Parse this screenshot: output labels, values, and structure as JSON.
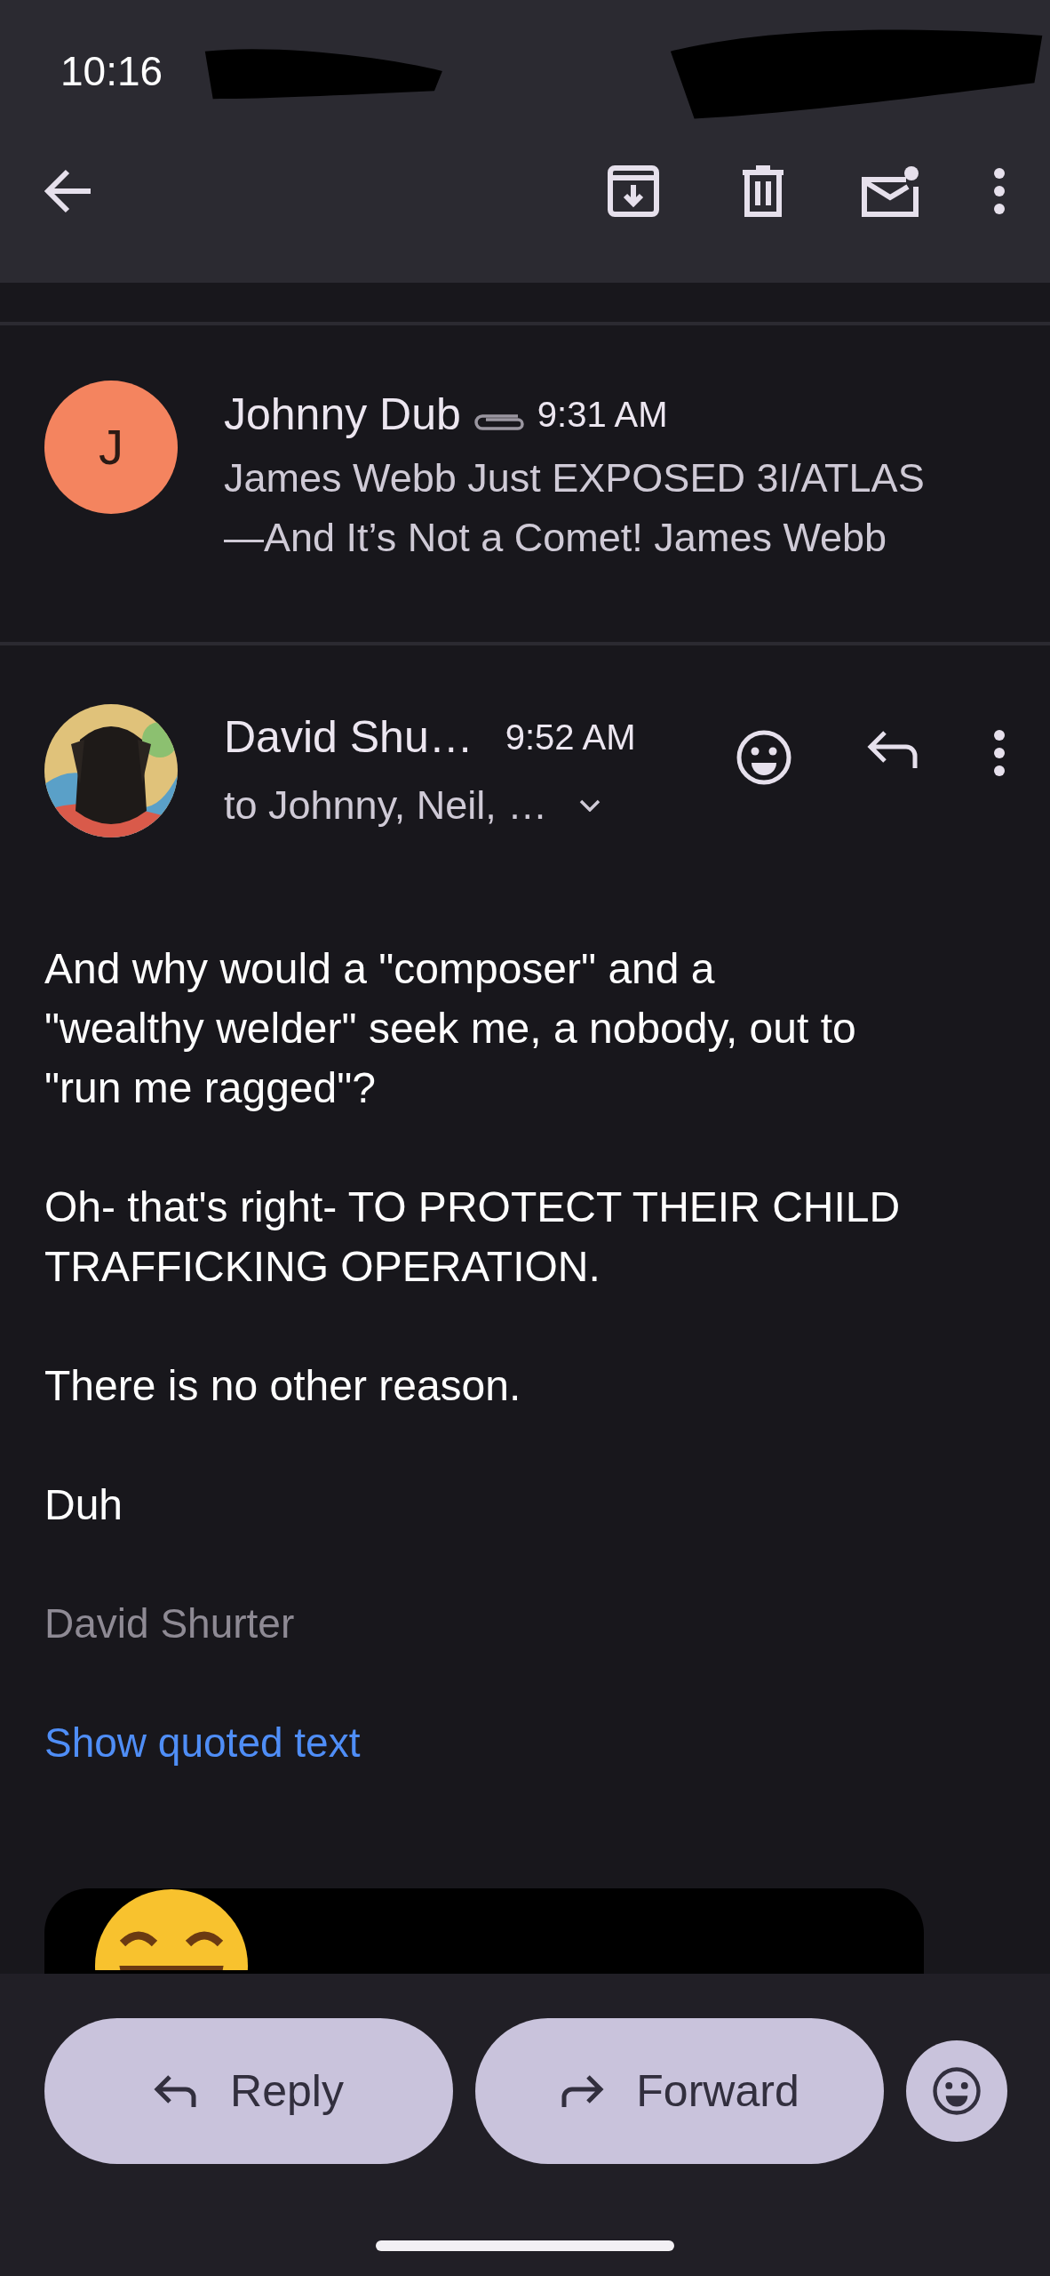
{
  "status_bar": {
    "time": "10:16"
  },
  "messages": [
    {
      "kind": "collapsed",
      "sender": "Johnny Dub",
      "avatar": {
        "kind": "letter",
        "letter": "J",
        "color": "#f4845f"
      },
      "has_attachment": true,
      "time": "9:31 AM",
      "snippet_lines": [
        "James Webb Just EXPOSED 3I/ATLAS",
        "—And It’s Not a Comet! James Webb"
      ]
    },
    {
      "kind": "expanded",
      "sender": "David Shu…",
      "avatar": {
        "kind": "picture"
      },
      "time": "9:52 AM",
      "recipients": "to Johnny, Neil, …",
      "body": [
        [
          "And why would a \"composer\" and a",
          "\"wealthy welder\" seek me, a nobody, out to",
          "\"run me ragged\"?"
        ],
        [
          "Oh- that's right- TO PROTECT THEIR CHILD",
          "TRAFFICKING OPERATION."
        ],
        [
          "There is no other reason."
        ],
        [
          "Duh"
        ]
      ],
      "signature": "David Shurter",
      "quoted_link": "Show quoted text"
    }
  ],
  "bottom_actions": [
    {
      "kind": "reply",
      "label": "Reply"
    },
    {
      "kind": "forward",
      "label": "Forward"
    }
  ]
}
